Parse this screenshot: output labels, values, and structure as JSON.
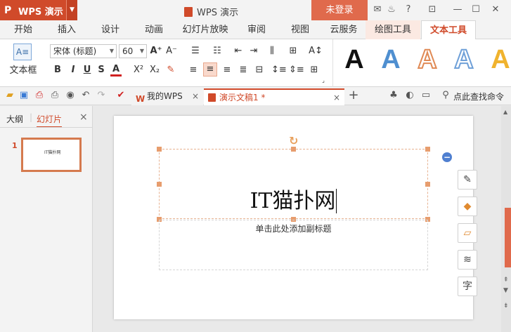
{
  "app": {
    "name": "WPS 演示",
    "title": "WPS 演示",
    "login_label": "未登录",
    "logo_glyph": "P"
  },
  "ribbon_tabs": [
    "开始",
    "插入",
    "设计",
    "动画",
    "幻灯片放映",
    "审阅",
    "视图",
    "云服务",
    "绘图工具",
    "文本工具"
  ],
  "active_tab": "文本工具",
  "ribbon": {
    "textbox_label": "文本框",
    "font_name": "宋体 (标题)",
    "font_size": "60",
    "bold": "B",
    "italic": "I",
    "underline": "U",
    "strike": "S",
    "font_color": "A",
    "superscript": "X²",
    "subscript": "X₂",
    "grow_font": "A⁺",
    "shrink_font": "A⁻",
    "styles": [
      {
        "letter": "A",
        "color": "#111111"
      },
      {
        "letter": "A",
        "color": "#4f8fd0"
      },
      {
        "letter": "A",
        "color": "#e08a55"
      },
      {
        "letter": "A",
        "color": "#6fa0d8"
      },
      {
        "letter": "A",
        "color": "#f0b32e"
      }
    ]
  },
  "quick_access": {
    "doc_tabs": [
      {
        "label": "我的WPS",
        "close": "×"
      },
      {
        "label": "演示文稿1 *",
        "close": "×"
      }
    ],
    "new_tab": "+",
    "search_label": "点此查找命令"
  },
  "left_panel": {
    "tabs": [
      "大纲",
      "幻灯片"
    ],
    "active": "幻灯片",
    "close": "×",
    "slide_number": "1",
    "thumb_text": "IT猫扑网"
  },
  "slide": {
    "title": "IT猫扑网",
    "subtitle_placeholder": "单击此处添加副标题"
  },
  "colors": {
    "accent": "#d04a2a",
    "selection": "#e79d6e"
  }
}
